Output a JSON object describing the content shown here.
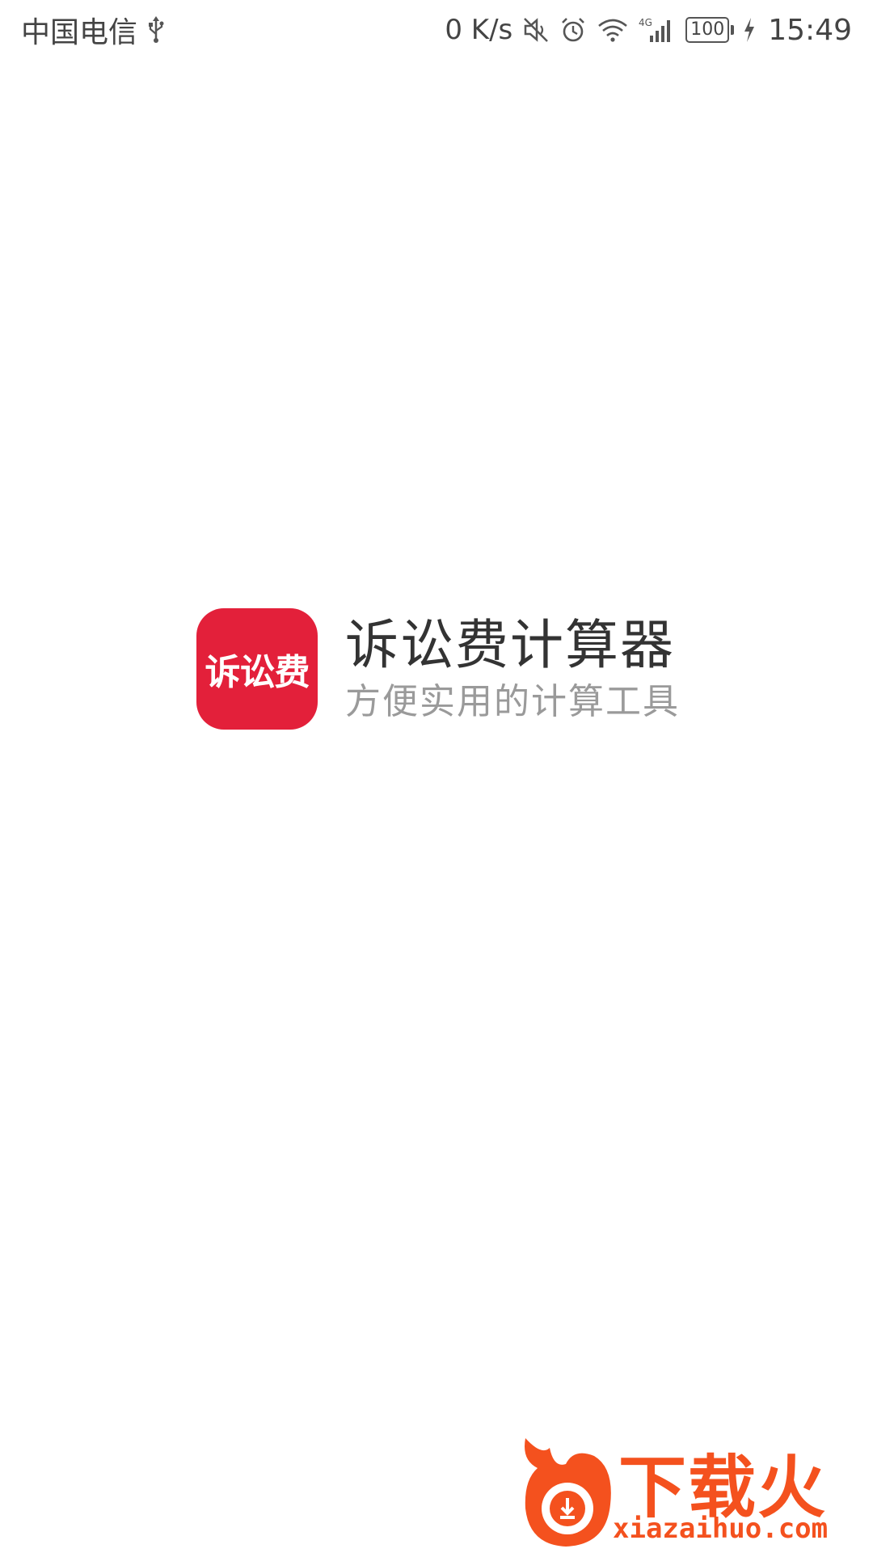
{
  "status_bar": {
    "carrier": "中国电信",
    "net_speed": "0 K/s",
    "network_type": "4G",
    "battery_level": "100",
    "time": "15:49",
    "icons": [
      "usb-icon",
      "mute-icon",
      "alarm-icon",
      "wifi-icon",
      "signal-icon",
      "battery-icon",
      "charging-icon"
    ]
  },
  "splash": {
    "icon_text": "诉讼费",
    "title": "诉讼费计算器",
    "subtitle": "方便实用的计算工具",
    "brand_color": "#e3203a"
  },
  "watermark": {
    "name": "下载火",
    "url": "xiazaihuo.com",
    "color": "#f4511e"
  }
}
